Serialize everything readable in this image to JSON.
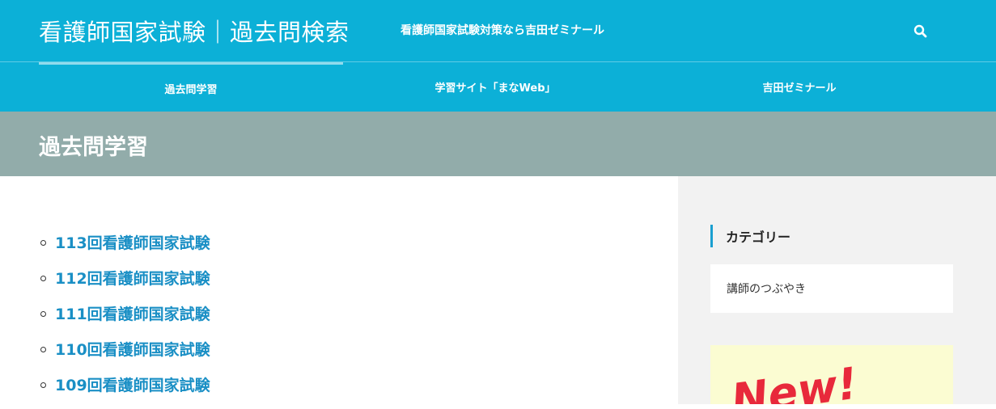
{
  "header": {
    "site_title": "看護師国家試験｜過去問検索",
    "site_description": "看護師国家試験対策なら吉田ゼミナール",
    "search_icon": "search-icon"
  },
  "nav": {
    "items": [
      {
        "label": "過去問学習",
        "active": true
      },
      {
        "label": "学習サイト「まなWeb」",
        "active": false
      },
      {
        "label": "吉田ゼミナール",
        "active": false
      }
    ]
  },
  "page": {
    "title": "過去問学習"
  },
  "main": {
    "exams": [
      {
        "label": "113回看護師国家試験"
      },
      {
        "label": "112回看護師国家試験"
      },
      {
        "label": "111回看護師国家試験"
      },
      {
        "label": "110回看護師国家試験"
      },
      {
        "label": "109回看護師国家試験"
      }
    ]
  },
  "sidebar": {
    "category_heading": "カテゴリー",
    "categories": [
      {
        "label": "講師のつぶやき"
      }
    ],
    "banner_text": "New!"
  },
  "colors": {
    "header_bg": "#0cb0d7",
    "page_header_bg": "#92acaa",
    "link": "#1a8fc5",
    "sidebar_bg": "#f2f2f2",
    "banner_bg": "#fbfcd2",
    "banner_text": "#e8293b"
  }
}
